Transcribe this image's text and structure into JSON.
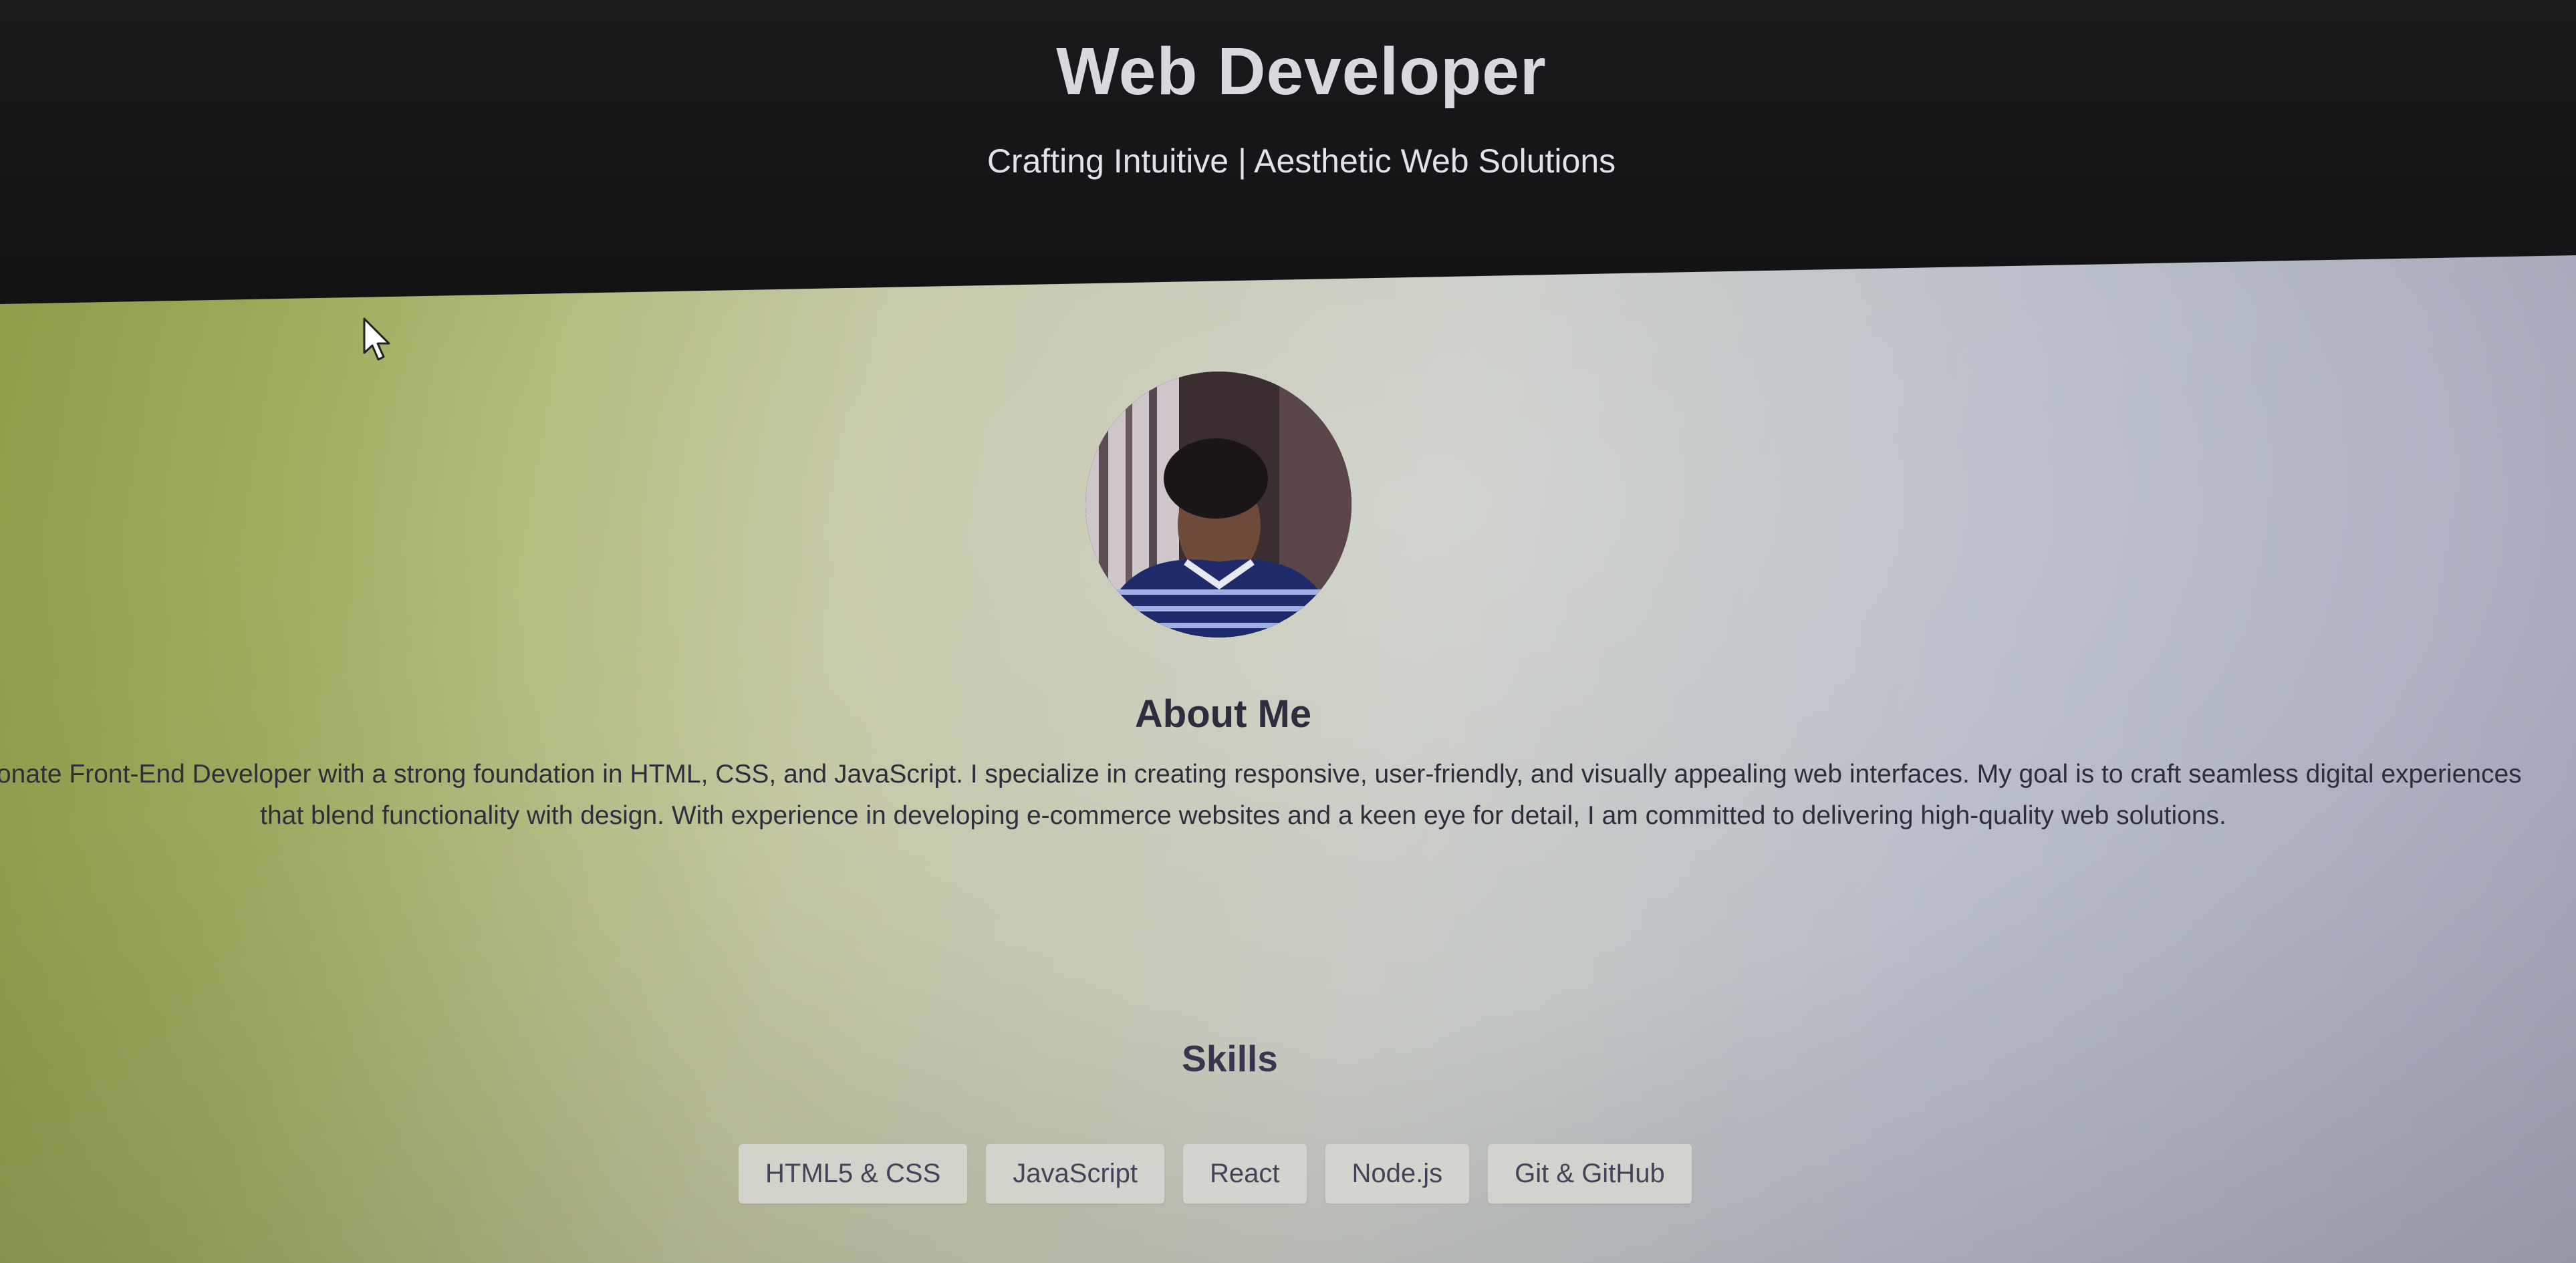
{
  "header": {
    "title": "Web Developer",
    "tagline": "Crafting Intuitive | Aesthetic Web Solutions"
  },
  "about": {
    "heading": "About Me",
    "text": "ssionate Front-End Developer with a strong foundation in HTML, CSS, and JavaScript. I specialize in creating responsive, user-friendly, and visually appealing web interfaces. My goal is to craft seamless digital experiences that blend functionality with design. With experience in developing e-commerce websites and a keen eye for detail, I am committed to delivering high-quality web solutions."
  },
  "skills": {
    "heading": "Skills",
    "items": [
      "HTML5 & CSS",
      "JavaScript",
      "React",
      "Node.js",
      "Git & GitHub"
    ]
  },
  "colors": {
    "header_bg": "#141416",
    "heading_text": "#2f2c40",
    "chip_bg": "#d6d6d0"
  }
}
